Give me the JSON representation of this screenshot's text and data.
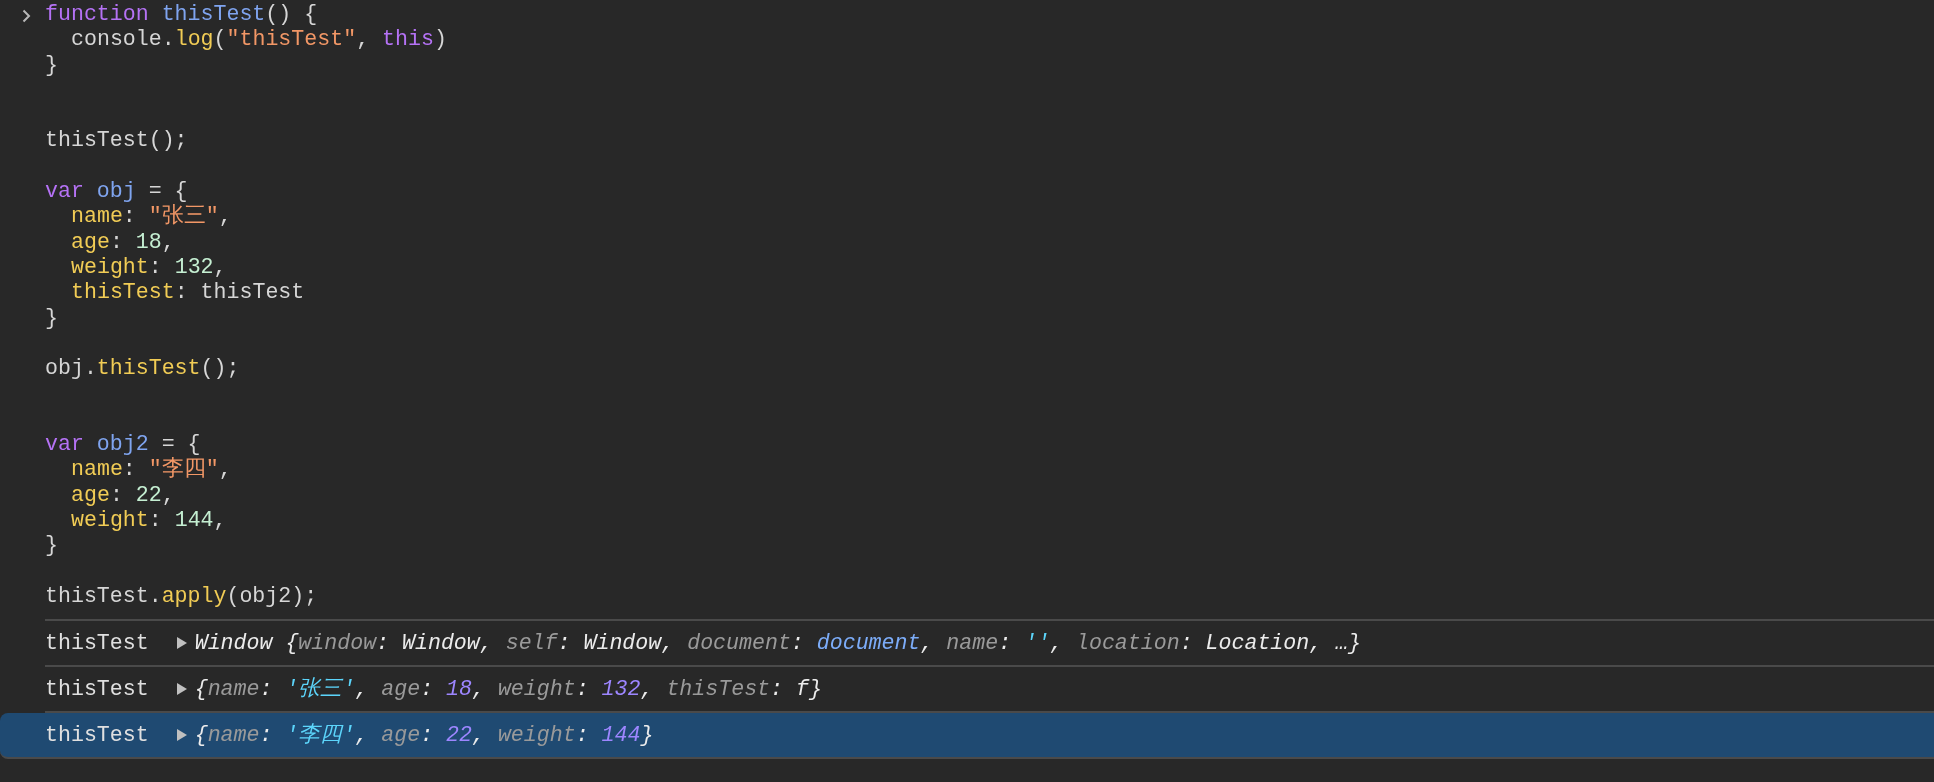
{
  "code": {
    "lines": [
      {
        "kind": "code",
        "indented": false,
        "tokens": [
          {
            "kind": "keyword",
            "text": "function "
          },
          {
            "kind": "def",
            "text": "thisTest"
          },
          {
            "kind": "plain",
            "text": "() {"
          }
        ]
      },
      {
        "kind": "code",
        "indented": true,
        "tokens": [
          {
            "kind": "plain",
            "text": "console."
          },
          {
            "kind": "prop",
            "text": "log"
          },
          {
            "kind": "plain",
            "text": "("
          },
          {
            "kind": "string",
            "text": "\"thisTest\""
          },
          {
            "kind": "plain",
            "text": ", "
          },
          {
            "kind": "keyword",
            "text": "this"
          },
          {
            "kind": "plain",
            "text": ")"
          }
        ]
      },
      {
        "kind": "code",
        "indented": false,
        "tokens": [
          {
            "kind": "plain",
            "text": "}"
          }
        ]
      },
      {
        "kind": "blank"
      },
      {
        "kind": "blank"
      },
      {
        "kind": "code",
        "indented": false,
        "tokens": [
          {
            "kind": "plain",
            "text": "thisTest();"
          }
        ]
      },
      {
        "kind": "blank"
      },
      {
        "kind": "code",
        "indented": false,
        "tokens": [
          {
            "kind": "keyword",
            "text": "var "
          },
          {
            "kind": "def",
            "text": "obj"
          },
          {
            "kind": "plain",
            "text": " = {"
          }
        ]
      },
      {
        "kind": "code",
        "indented": true,
        "tokens": [
          {
            "kind": "prop",
            "text": "name"
          },
          {
            "kind": "plain",
            "text": ": "
          },
          {
            "kind": "string",
            "text": "\"张三\""
          },
          {
            "kind": "plain",
            "text": ","
          }
        ]
      },
      {
        "kind": "code",
        "indented": true,
        "tokens": [
          {
            "kind": "prop",
            "text": "age"
          },
          {
            "kind": "plain",
            "text": ": "
          },
          {
            "kind": "number",
            "text": "18"
          },
          {
            "kind": "plain",
            "text": ","
          }
        ]
      },
      {
        "kind": "code",
        "indented": true,
        "tokens": [
          {
            "kind": "prop",
            "text": "weight"
          },
          {
            "kind": "plain",
            "text": ": "
          },
          {
            "kind": "number",
            "text": "132"
          },
          {
            "kind": "plain",
            "text": ","
          }
        ]
      },
      {
        "kind": "code",
        "indented": true,
        "tokens": [
          {
            "kind": "prop",
            "text": "thisTest"
          },
          {
            "kind": "plain",
            "text": ": thisTest"
          }
        ]
      },
      {
        "kind": "code",
        "indented": false,
        "tokens": [
          {
            "kind": "plain",
            "text": "}"
          }
        ]
      },
      {
        "kind": "blank"
      },
      {
        "kind": "code",
        "indented": false,
        "tokens": [
          {
            "kind": "plain",
            "text": "obj."
          },
          {
            "kind": "prop",
            "text": "thisTest"
          },
          {
            "kind": "plain",
            "text": "();"
          }
        ]
      },
      {
        "kind": "blank"
      },
      {
        "kind": "blank"
      },
      {
        "kind": "code",
        "indented": false,
        "tokens": [
          {
            "kind": "keyword",
            "text": "var "
          },
          {
            "kind": "def",
            "text": "obj2"
          },
          {
            "kind": "plain",
            "text": " = {"
          }
        ]
      },
      {
        "kind": "code",
        "indented": true,
        "tokens": [
          {
            "kind": "prop",
            "text": "name"
          },
          {
            "kind": "plain",
            "text": ": "
          },
          {
            "kind": "string",
            "text": "\"李四\""
          },
          {
            "kind": "plain",
            "text": ","
          }
        ]
      },
      {
        "kind": "code",
        "indented": true,
        "tokens": [
          {
            "kind": "prop",
            "text": "age"
          },
          {
            "kind": "plain",
            "text": ": "
          },
          {
            "kind": "number",
            "text": "22"
          },
          {
            "kind": "plain",
            "text": ","
          }
        ]
      },
      {
        "kind": "code",
        "indented": true,
        "tokens": [
          {
            "kind": "prop",
            "text": "weight"
          },
          {
            "kind": "plain",
            "text": ": "
          },
          {
            "kind": "number",
            "text": "144"
          },
          {
            "kind": "plain",
            "text": ","
          }
        ]
      },
      {
        "kind": "code",
        "indented": false,
        "tokens": [
          {
            "kind": "plain",
            "text": "}"
          }
        ]
      },
      {
        "kind": "blank"
      },
      {
        "kind": "code",
        "indented": false,
        "tokens": [
          {
            "kind": "plain",
            "text": "thisTest."
          },
          {
            "kind": "prop",
            "text": "apply"
          },
          {
            "kind": "plain",
            "text": "(obj2);"
          }
        ]
      }
    ]
  },
  "log_rows": [
    {
      "label": "thisTest",
      "selected": false,
      "preview": [
        {
          "kind": "punct",
          "text": "Window {"
        },
        {
          "kind": "key",
          "text": "window"
        },
        {
          "kind": "punct",
          "text": ": "
        },
        {
          "kind": "value",
          "text": "Window"
        },
        {
          "kind": "punct",
          "text": ", "
        },
        {
          "kind": "key",
          "text": "self"
        },
        {
          "kind": "punct",
          "text": ": "
        },
        {
          "kind": "value",
          "text": "Window"
        },
        {
          "kind": "punct",
          "text": ", "
        },
        {
          "kind": "key",
          "text": "document"
        },
        {
          "kind": "punct",
          "text": ": "
        },
        {
          "kind": "ref",
          "text": "document"
        },
        {
          "kind": "punct",
          "text": ", "
        },
        {
          "kind": "key",
          "text": "name"
        },
        {
          "kind": "punct",
          "text": ": "
        },
        {
          "kind": "string",
          "text": "''"
        },
        {
          "kind": "punct",
          "text": ", "
        },
        {
          "kind": "key",
          "text": "location"
        },
        {
          "kind": "punct",
          "text": ": "
        },
        {
          "kind": "value",
          "text": "Location"
        },
        {
          "kind": "punct",
          "text": ", …}"
        }
      ]
    },
    {
      "label": "thisTest",
      "selected": false,
      "preview": [
        {
          "kind": "punct",
          "text": "{"
        },
        {
          "kind": "key",
          "text": "name"
        },
        {
          "kind": "punct",
          "text": ": "
        },
        {
          "kind": "string",
          "text": "'张三'"
        },
        {
          "kind": "punct",
          "text": ", "
        },
        {
          "kind": "key",
          "text": "age"
        },
        {
          "kind": "punct",
          "text": ": "
        },
        {
          "kind": "number",
          "text": "18"
        },
        {
          "kind": "punct",
          "text": ", "
        },
        {
          "kind": "key",
          "text": "weight"
        },
        {
          "kind": "punct",
          "text": ": "
        },
        {
          "kind": "number",
          "text": "132"
        },
        {
          "kind": "punct",
          "text": ", "
        },
        {
          "kind": "key",
          "text": "thisTest"
        },
        {
          "kind": "punct",
          "text": ": "
        },
        {
          "kind": "value",
          "text": "f"
        },
        {
          "kind": "punct",
          "text": "}"
        }
      ]
    },
    {
      "label": "thisTest",
      "selected": true,
      "preview": [
        {
          "kind": "punct",
          "text": "{"
        },
        {
          "kind": "key",
          "text": "name"
        },
        {
          "kind": "punct",
          "text": ": "
        },
        {
          "kind": "string",
          "text": "'李四'"
        },
        {
          "kind": "punct",
          "text": ", "
        },
        {
          "kind": "key",
          "text": "age"
        },
        {
          "kind": "punct",
          "text": ": "
        },
        {
          "kind": "number",
          "text": "22"
        },
        {
          "kind": "punct",
          "text": ", "
        },
        {
          "kind": "key",
          "text": "weight"
        },
        {
          "kind": "punct",
          "text": ": "
        },
        {
          "kind": "number",
          "text": "144"
        },
        {
          "kind": "punct",
          "text": "}"
        }
      ]
    }
  ]
}
